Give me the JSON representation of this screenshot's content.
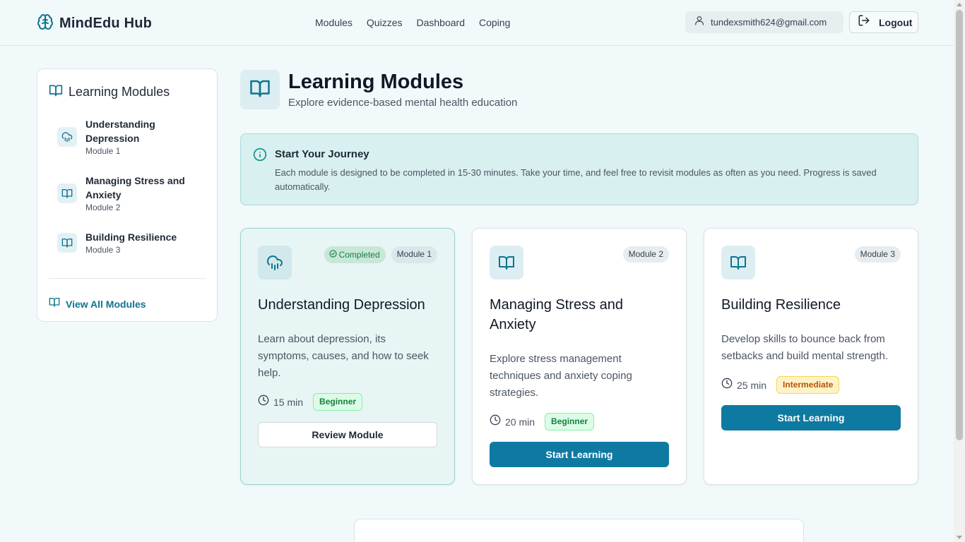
{
  "header": {
    "brand_name": "MindEdu Hub",
    "nav": [
      "Modules",
      "Quizzes",
      "Dashboard",
      "Coping"
    ],
    "user_email": "tundexsmith624@gmail.com",
    "logout_label": "Logout"
  },
  "sidebar": {
    "title": "Learning Modules",
    "items": [
      {
        "title": "Understanding Depression",
        "subtitle": "Module 1",
        "icon": "cloud-rain-icon"
      },
      {
        "title": "Managing Stress and Anxiety",
        "subtitle": "Module 2",
        "icon": "book-open-icon"
      },
      {
        "title": "Building Resilience",
        "subtitle": "Module 3",
        "icon": "book-open-icon"
      }
    ],
    "view_all_label": "View All Modules"
  },
  "page": {
    "title": "Learning Modules",
    "subtitle": "Explore evidence-based mental health education"
  },
  "banner": {
    "title": "Start Your Journey",
    "text": "Each module is designed to be completed in 15-30 minutes. Take your time, and feel free to revisit modules as often as you need. Progress is saved automatically."
  },
  "cards": [
    {
      "module_label": "Module 1",
      "completed_label": "Completed",
      "title": "Understanding Depression",
      "description": "Learn about depression, its symptoms, causes, and how to seek help.",
      "duration": "15 min",
      "level": "Beginner",
      "button_label": "Review Module",
      "icon": "cloud-rain-icon"
    },
    {
      "module_label": "Module 2",
      "title": "Managing Stress and Anxiety",
      "description": "Explore stress management techniques and anxiety coping strategies.",
      "duration": "20 min",
      "level": "Beginner",
      "button_label": "Start Learning",
      "icon": "book-open-icon"
    },
    {
      "module_label": "Module 3",
      "title": "Building Resilience",
      "description": "Develop skills to bounce back from setbacks and build mental strength.",
      "duration": "25 min",
      "level": "Intermediate",
      "button_label": "Start Learning",
      "icon": "book-open-icon"
    }
  ],
  "colors": {
    "accent": "#0e7aa2",
    "page_bg": "#f1f9fa",
    "banner_bg": "#d8f0f0",
    "completed_card_bg": "#e7f5f4"
  }
}
